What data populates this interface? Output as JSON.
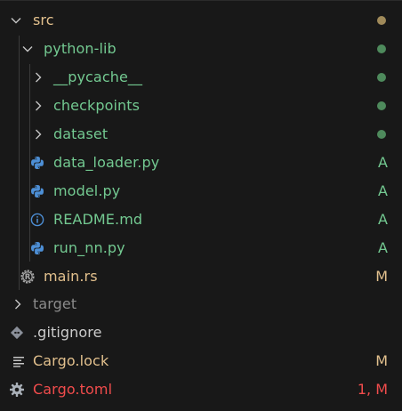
{
  "colors": {
    "background": "#181818",
    "untracked": "#73c991",
    "modified": "#e2c08d",
    "error": "#f14c4c",
    "ignored": "#8c8c8c",
    "default_text": "#cccccc",
    "python_icon": "#4d8fd6",
    "info_icon": "#4d8fd6",
    "folder_dot_src": "#a08a5a",
    "folder_dot_green": "#4e8a5c"
  },
  "tree": {
    "src": {
      "label": "src",
      "icon": "chevron-down-icon",
      "status_icon": "modified-dot"
    },
    "python_lib": {
      "label": "python-lib",
      "icon": "chevron-down-icon",
      "status_icon": "untracked-dot"
    },
    "pycache": {
      "label": "__pycache__",
      "icon": "chevron-right-icon",
      "status_icon": "untracked-dot"
    },
    "checkpoints": {
      "label": "checkpoints",
      "icon": "chevron-right-icon",
      "status_icon": "untracked-dot"
    },
    "dataset": {
      "label": "dataset",
      "icon": "chevron-right-icon",
      "status_icon": "untracked-dot"
    },
    "data_loader": {
      "label": "data_loader.py",
      "icon": "python-icon",
      "status": "A"
    },
    "model": {
      "label": "model.py",
      "icon": "python-icon",
      "status": "A"
    },
    "readme": {
      "label": "README.md",
      "icon": "info-icon",
      "status": "A"
    },
    "run_nn": {
      "label": "run_nn.py",
      "icon": "python-icon",
      "status": "A"
    },
    "main_rs": {
      "label": "main.rs",
      "icon": "rust-icon",
      "status": "M"
    },
    "target": {
      "label": "target",
      "icon": "chevron-right-icon"
    },
    "gitignore": {
      "label": ".gitignore",
      "icon": "git-icon"
    },
    "cargo_lock": {
      "label": "Cargo.lock",
      "icon": "lines-icon",
      "status": "M"
    },
    "cargo_toml": {
      "label": "Cargo.toml",
      "icon": "gear-icon",
      "status": "1, M"
    }
  }
}
